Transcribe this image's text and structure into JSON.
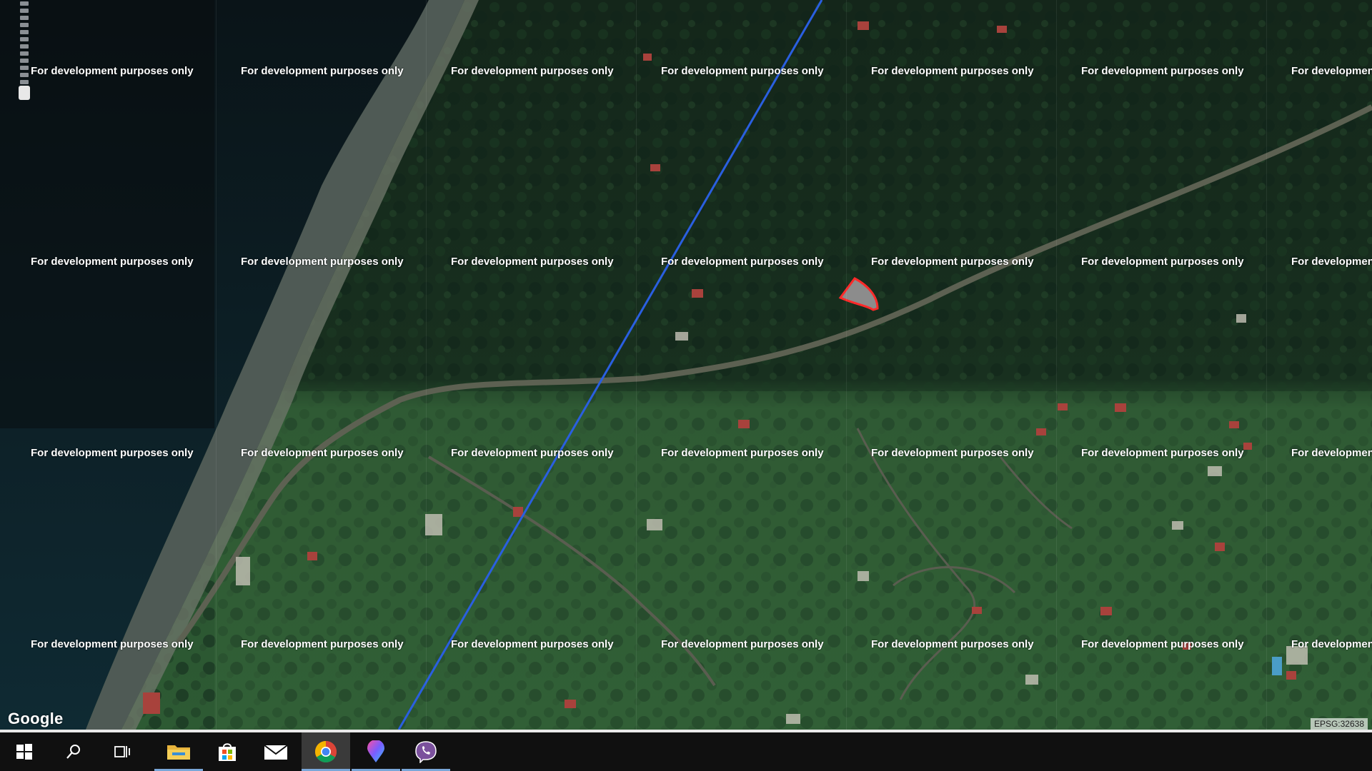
{
  "map": {
    "watermark_text": "For development purposes only",
    "attribution_logo": "Google",
    "projection_label": "EPSG:32638",
    "overlay_line_color": "#2a5fe0",
    "parcel_fill": "#8c8c8c",
    "parcel_stroke": "#ff2a2a",
    "road_color": "#6b6b5e"
  },
  "taskbar": {
    "items": [
      {
        "name": "start-button",
        "icon": "windows-start-icon"
      },
      {
        "name": "search-button",
        "icon": "search-icon"
      },
      {
        "name": "task-view-button",
        "icon": "task-view-icon"
      },
      {
        "name": "file-explorer-button",
        "icon": "folder-icon"
      },
      {
        "name": "store-button",
        "icon": "store-bag-icon"
      },
      {
        "name": "mail-button",
        "icon": "mail-icon"
      },
      {
        "name": "chrome-button",
        "icon": "chrome-icon"
      },
      {
        "name": "maps-pin-button",
        "icon": "map-pin-icon"
      },
      {
        "name": "viber-button",
        "icon": "viber-icon"
      }
    ]
  }
}
